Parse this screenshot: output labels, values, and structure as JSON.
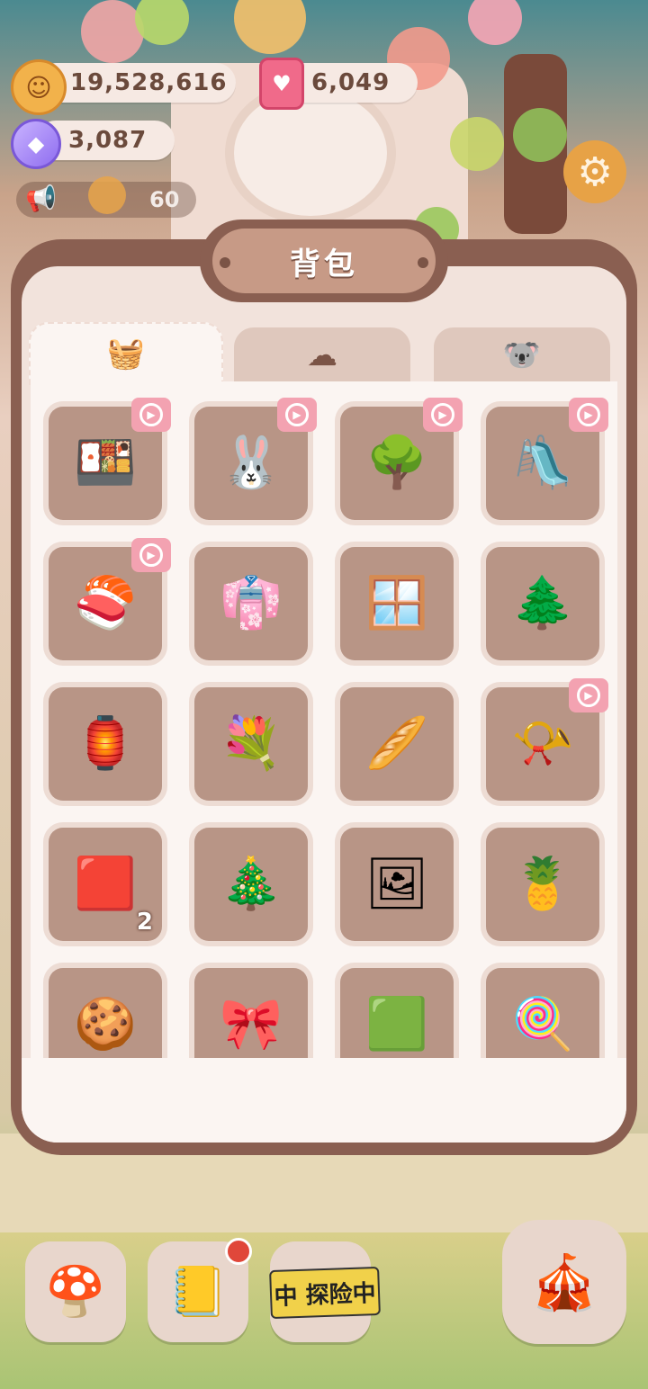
{
  "currencies": {
    "cookies": "19,528,616",
    "gems": "6,049",
    "crystals": "3,087"
  },
  "notice": {
    "count": "60"
  },
  "bag": {
    "title": "背包",
    "tabs": [
      {
        "icon": "box-icon",
        "active": true
      },
      {
        "icon": "cookie-character-icon",
        "active": false
      },
      {
        "icon": "koala-icon",
        "active": false
      }
    ],
    "items": [
      {
        "icon": "picnic-table-icon",
        "glyph": "🍱",
        "count": "",
        "video": true
      },
      {
        "icon": "bunny-plush-icon",
        "glyph": "🐰",
        "count": "",
        "video": true
      },
      {
        "icon": "tree-decor-icon",
        "glyph": "🌳",
        "count": "",
        "video": true
      },
      {
        "icon": "slide-icon",
        "glyph": "🛝",
        "count": "",
        "video": true
      },
      {
        "icon": "bento-table-icon",
        "glyph": "🍣",
        "count": "",
        "video": true
      },
      {
        "icon": "clothes-rack-icon",
        "glyph": "👘",
        "count": "",
        "video": false
      },
      {
        "icon": "folding-screen-icon",
        "glyph": "🪟",
        "count": "",
        "video": false
      },
      {
        "icon": "bonsai-icon",
        "glyph": "🌲",
        "count": "",
        "video": false
      },
      {
        "icon": "lantern-icon",
        "glyph": "🏮",
        "count": "",
        "video": false
      },
      {
        "icon": "flower-vase-icon",
        "glyph": "💐",
        "count": "",
        "video": false
      },
      {
        "icon": "bread-rug-icon",
        "glyph": "🥖",
        "count": "",
        "video": false
      },
      {
        "icon": "gramophone-icon",
        "glyph": "📯",
        "count": "",
        "video": true
      },
      {
        "icon": "red-carpet-icon",
        "glyph": "🟥",
        "count": "2",
        "video": false
      },
      {
        "icon": "christmas-tree-icon",
        "glyph": "🎄",
        "count": "",
        "video": false
      },
      {
        "icon": "picture-frames-icon",
        "glyph": "🖼",
        "count": "",
        "video": false
      },
      {
        "icon": "pineapple-pot-icon",
        "glyph": "🍍",
        "count": "",
        "video": false
      },
      {
        "icon": "cookie-plates-icon",
        "glyph": "🍪",
        "count": "",
        "video": false
      },
      {
        "icon": "wreath-icon",
        "glyph": "🎀",
        "count": "",
        "video": false
      },
      {
        "icon": "green-rug-icon",
        "glyph": "🟩",
        "count": "",
        "video": false
      },
      {
        "icon": "cotton-candy-tree-icon",
        "glyph": "🍭",
        "count": "",
        "video": false
      }
    ]
  },
  "bottom": {
    "exploring_label": "中 探险中"
  },
  "colors": {
    "panel_frame": "#8a5f51",
    "panel_bg": "#f2e3dc",
    "slot_bg": "#b89586",
    "video_badge": "#f3a2b1"
  }
}
